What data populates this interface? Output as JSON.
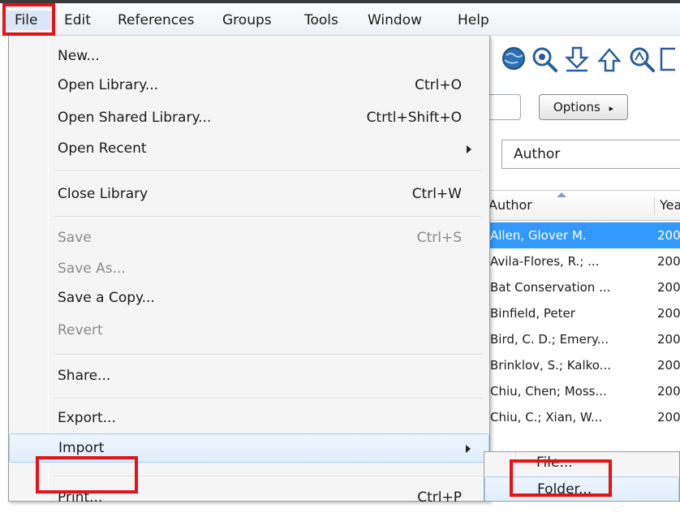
{
  "menubar": {
    "items": [
      {
        "label": "File"
      },
      {
        "label": "Edit"
      },
      {
        "label": "References"
      },
      {
        "label": "Groups"
      },
      {
        "label": "Tools"
      },
      {
        "label": "Window"
      },
      {
        "label": "Help"
      }
    ]
  },
  "file_menu": {
    "items": [
      {
        "label": "New...",
        "shortcut": ""
      },
      {
        "label": "Open Library...",
        "shortcut": "Ctrl+O"
      },
      {
        "label": "Open Shared Library...",
        "shortcut": "Ctrtl+Shift+O"
      },
      {
        "label": "Open Recent",
        "shortcut": ""
      },
      {
        "label": "Close Library",
        "shortcut": "Ctrl+W"
      },
      {
        "label": "Save",
        "shortcut": "Ctrl+S"
      },
      {
        "label": "Save As...",
        "shortcut": ""
      },
      {
        "label": "Save a Copy...",
        "shortcut": ""
      },
      {
        "label": "Revert",
        "shortcut": ""
      },
      {
        "label": "Share...",
        "shortcut": ""
      },
      {
        "label": "Export...",
        "shortcut": ""
      },
      {
        "label": "Import",
        "shortcut": ""
      },
      {
        "label": "Print...",
        "shortcut": "Ctrl+P"
      }
    ]
  },
  "import_submenu": {
    "items": [
      {
        "label": "File..."
      },
      {
        "label": "Folder..."
      }
    ]
  },
  "toolbar": {
    "icons": [
      "globe-search-icon",
      "search-icon",
      "download-icon",
      "upload-icon",
      "find-fulltext-icon"
    ],
    "options_label": "Options"
  },
  "search_field": {
    "value": "Author"
  },
  "reference_list": {
    "columns": [
      "Author",
      "Yea"
    ],
    "rows": [
      {
        "author": "Allen, Glover M.",
        "year": "200"
      },
      {
        "author": "Avila-Flores, R.; ...",
        "year": "200"
      },
      {
        "author": "Bat Conservation ...",
        "year": "200"
      },
      {
        "author": "Binfield, Peter",
        "year": "200"
      },
      {
        "author": "Bird, C. D.; Emery...",
        "year": "200"
      },
      {
        "author": "Brinklov, S.; Kalko...",
        "year": "200"
      },
      {
        "author": "Chiu, Chen; Moss...",
        "year": "200"
      },
      {
        "author": "Chiu, C.; Xian, W...",
        "year": "200"
      }
    ]
  },
  "colors": {
    "highlight_box": "#e2141a",
    "selected_row": "#3399ff",
    "menu_bg": "#f5f5f5"
  }
}
